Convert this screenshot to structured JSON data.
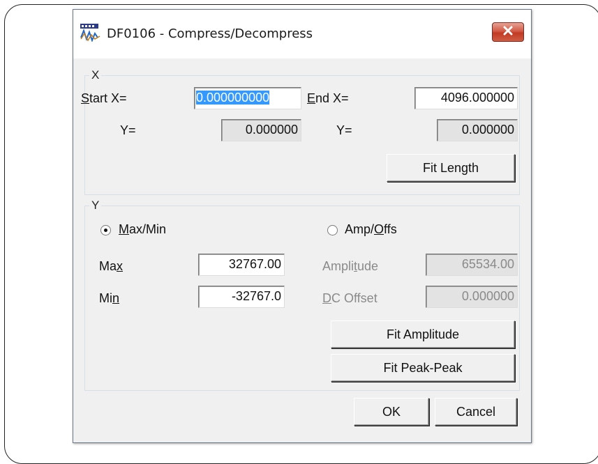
{
  "window": {
    "title": "DF0106 - Compress/Decompress"
  },
  "x_group": {
    "legend": "X",
    "start_label_accel": "S",
    "start_label_rest": "tart X=",
    "start_x_value": "0.000000000",
    "end_label_accel": "E",
    "end_label_rest": "nd  X=",
    "end_x_value": "4096.000000",
    "start_y_label": "Y=",
    "start_y_value": "0.000000",
    "end_y_label": "Y=",
    "end_y_value": "0.000000",
    "fit_length_label": "Fit Length"
  },
  "y_group": {
    "legend": "Y",
    "maxmin_accel": "M",
    "maxmin_rest": "ax/Min",
    "ampoffs_pre": "Amp/",
    "ampoffs_accel": "O",
    "ampoffs_rest": "ffs",
    "max_pre": "Ma",
    "max_accel": "x",
    "max_value": "32767.00",
    "min_pre": "Mi",
    "min_accel": "n",
    "min_value": "-32767.0",
    "amplitude_pre": "Ampli",
    "amplitude_accel": "t",
    "amplitude_rest": "ude",
    "amplitude_value": "65534.00",
    "dcoffset_accel": "D",
    "dcoffset_rest": "C Offset",
    "dcoffset_value": "0.000000",
    "fit_amplitude_label": "Fit Amplitude",
    "fit_peak_label": "Fit Peak-Peak",
    "mode_selected": "Max/Min"
  },
  "footer": {
    "ok_label": "OK",
    "cancel_label": "Cancel"
  }
}
